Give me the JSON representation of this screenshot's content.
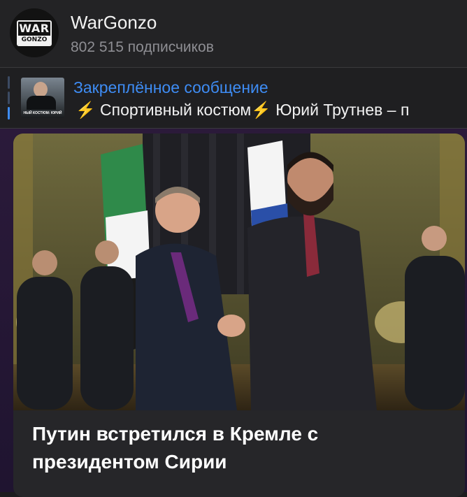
{
  "channel": {
    "name": "WarGonzo",
    "subscribers": "802 515 подписчиков",
    "avatar_logo": {
      "top": "WAR",
      "bottom": "GONZO"
    }
  },
  "pinned": {
    "label": "Закреплённое сообщение",
    "text": "⚡️ Спортивный костюм⚡️ Юрий Трутнев – п",
    "thumbnail_caption": "НЫЙ КОСТЮМ: ЮРИЙ"
  },
  "post": {
    "title": "Путин встретился в Кремле с президентом Сирии",
    "image_icon": "photo-image"
  },
  "colors": {
    "accent": "#3e8cf4",
    "background": "#1c1c1e",
    "card": "#262629",
    "feed_background": "#2b1a3a"
  }
}
